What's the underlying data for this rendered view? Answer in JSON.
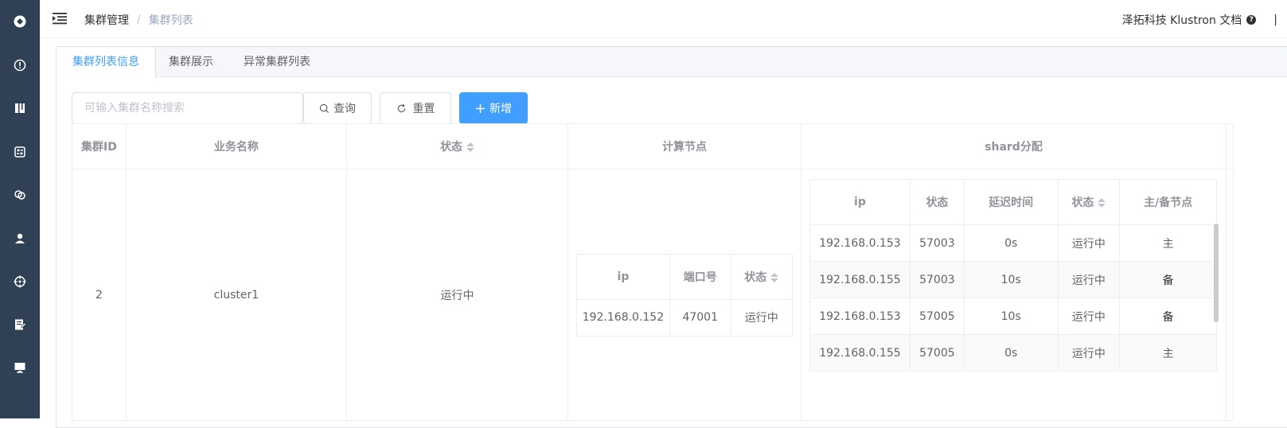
{
  "sidebar": {
    "icons": [
      "logo-icon",
      "info-icon",
      "book-icon",
      "dashboard-icon",
      "link-icon",
      "user-icon",
      "target-icon",
      "edit-doc-icon",
      "monitor-icon"
    ]
  },
  "header": {
    "breadcrumb": {
      "parent": "集群管理",
      "separator": "/",
      "current": "集群列表"
    },
    "right_text": "泽拓科技 Klustron 文档",
    "help": "?",
    "divider": "|"
  },
  "tabs": [
    {
      "label": "集群列表信息",
      "active": true
    },
    {
      "label": "集群展示",
      "active": false
    },
    {
      "label": "异常集群列表",
      "active": false
    }
  ],
  "toolbar": {
    "search_placeholder": "可输入集群名称搜索",
    "search_value": "",
    "query_label": "查询",
    "reset_label": "重置",
    "add_label": "新增"
  },
  "table": {
    "headers": {
      "id": "集群ID",
      "name": "业务名称",
      "status": "状态",
      "compute": "计算节点",
      "shard": "shard分配"
    },
    "row": {
      "id": "2",
      "name": "cluster1",
      "status": "运行中"
    }
  },
  "compute_nodes": {
    "headers": {
      "ip": "ip",
      "port": "端口号",
      "status": "状态"
    },
    "rows": [
      {
        "ip": "192.168.0.152",
        "port": "47001",
        "status": "运行中"
      }
    ]
  },
  "shard_nodes": {
    "headers": {
      "ip": "ip",
      "status1": "状态",
      "delay": "延迟时间",
      "status2": "状态",
      "role": "主/备节点"
    },
    "rows": [
      {
        "ip": "192.168.0.153",
        "port": "57003",
        "delay": "0s",
        "status": "运行中",
        "role": "主"
      },
      {
        "ip": "192.168.0.155",
        "port": "57003",
        "delay": "10s",
        "status": "运行中",
        "role": "备"
      },
      {
        "ip": "192.168.0.153",
        "port": "57005",
        "delay": "10s",
        "status": "运行中",
        "role": "备"
      },
      {
        "ip": "192.168.0.155",
        "port": "57005",
        "delay": "0s",
        "status": "运行中",
        "role": "主"
      }
    ]
  },
  "colors": {
    "sidebar_bg": "#304156",
    "primary": "#409eff",
    "running": "#13ce66"
  }
}
